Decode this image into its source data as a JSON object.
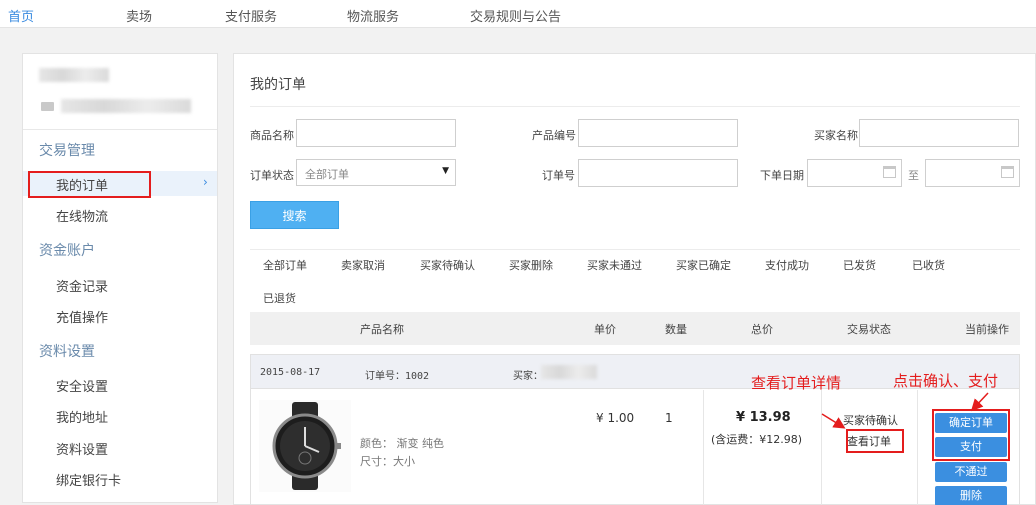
{
  "topnav": {
    "items": [
      "首页",
      "卖场",
      "支付服务",
      "物流服务",
      "交易规则与公告"
    ]
  },
  "sidebar": {
    "groups": [
      {
        "title": "交易管理",
        "items": [
          "我的订单",
          "在线物流"
        ]
      },
      {
        "title": "资金账户",
        "items": [
          "资金记录",
          "充值操作"
        ]
      },
      {
        "title": "资料设置",
        "items": [
          "安全设置",
          "我的地址",
          "资料设置",
          "绑定银行卡"
        ]
      }
    ],
    "active_arrow": "›"
  },
  "main": {
    "title": "我的订单",
    "filters": {
      "product_name_label": "商品名称",
      "product_no_label": "产品编号",
      "buyer_name_label": "买家名称",
      "order_status_label": "订单状态",
      "order_status_value": "全部订单",
      "order_no_label": "订单号",
      "order_date_label": "下单日期",
      "date_to": "至",
      "search_button": "搜索"
    },
    "tabs": [
      "全部订单",
      "卖家取消",
      "买家待确认",
      "买家删除",
      "买家未通过",
      "买家已确定",
      "支付成功",
      "已发货",
      "已收货",
      "已退货"
    ],
    "table_headers": [
      "产品名称",
      "单价",
      "数量",
      "总价",
      "交易状态",
      "当前操作"
    ],
    "order": {
      "date": "2015-08-17",
      "order_no": "订单号：1002",
      "buyer_label": "买家：",
      "attrs": [
        "颜色：  渐变 纯色",
        "尺寸：大小"
      ],
      "unit_price": "¥ 1.00",
      "quantity": "1",
      "total": "¥ 13.98",
      "total_sub": "(含运费：¥12.98)",
      "status": "买家待确认",
      "view_link": "查看订单",
      "actions": [
        "确定订单",
        "支付",
        "不通过",
        "删除"
      ]
    }
  },
  "annotations": {
    "view_detail": "查看订单详情",
    "confirm_pay": "点击确认、支付"
  },
  "colors": {
    "accent": "#3b8fe0",
    "search": "#4fb0f2",
    "annotation": "#e41d1d"
  }
}
